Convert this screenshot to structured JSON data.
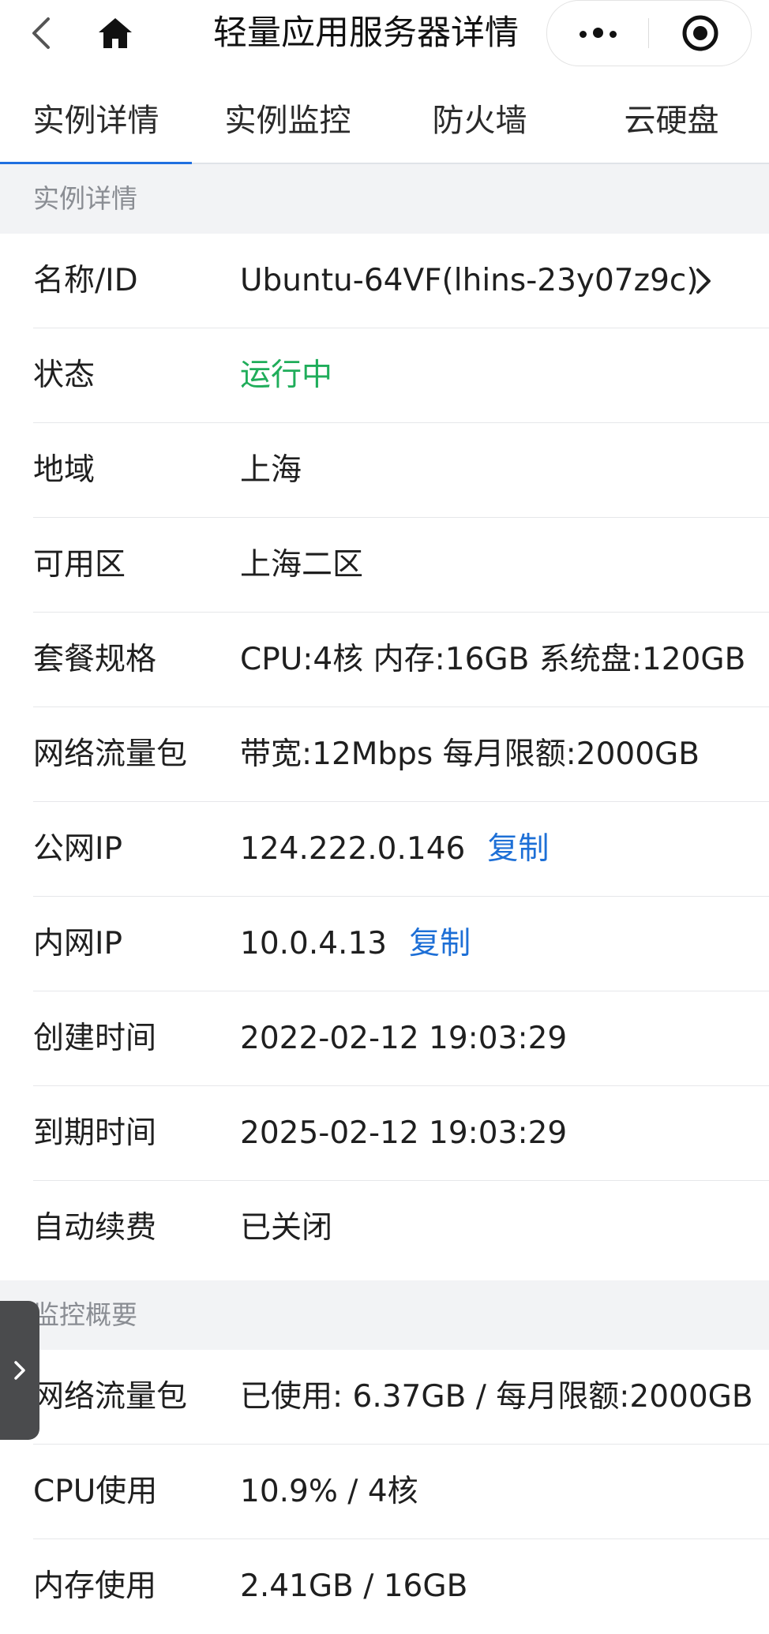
{
  "header": {
    "title": "轻量应用服务器详情",
    "back_icon": "chevron-left-icon",
    "home_icon": "home-icon",
    "more_icon": "more-dots-icon",
    "close_icon": "target-close-icon"
  },
  "tabs": [
    {
      "label": "实例详情",
      "active": true
    },
    {
      "label": "实例监控",
      "active": false
    },
    {
      "label": "防火墙",
      "active": false
    },
    {
      "label": "云硬盘",
      "active": false
    }
  ],
  "instance_section": {
    "title": "实例详情",
    "rows": [
      {
        "label": "名称/ID",
        "value": "Ubuntu-64VF(lhins-23y07z9c)"
      },
      {
        "label": "状态",
        "value": "运行中"
      },
      {
        "label": "地域",
        "value": "上海"
      },
      {
        "label": "可用区",
        "value": "上海二区"
      },
      {
        "label": "套餐规格",
        "value": "CPU:4核 内存:16GB 系统盘:120GB"
      },
      {
        "label": "网络流量包",
        "value": "带宽:12Mbps 每月限额:2000GB"
      },
      {
        "label": "公网IP",
        "value": "124.222.0.146",
        "action": "复制"
      },
      {
        "label": "内网IP",
        "value": "10.0.4.13",
        "action": "复制"
      },
      {
        "label": "创建时间",
        "value": "2022-02-12 19:03:29"
      },
      {
        "label": "到期时间",
        "value": "2025-02-12 19:03:29"
      },
      {
        "label": "自动续费",
        "value": "已关闭"
      }
    ]
  },
  "monitor_section": {
    "title": "监控概要",
    "rows": [
      {
        "label": "网络流量包",
        "value": "已使用: 6.37GB / 每月限额:2000GB"
      },
      {
        "label": "CPU使用",
        "value": "10.9% / 4核"
      },
      {
        "label": "内存使用",
        "value": "2.41GB / 16GB"
      }
    ]
  },
  "colors": {
    "accent_blue": "#1f6fe0",
    "link_blue": "#1d6fd6",
    "status_green": "#1fad5a",
    "section_bg": "#f2f3f5"
  }
}
